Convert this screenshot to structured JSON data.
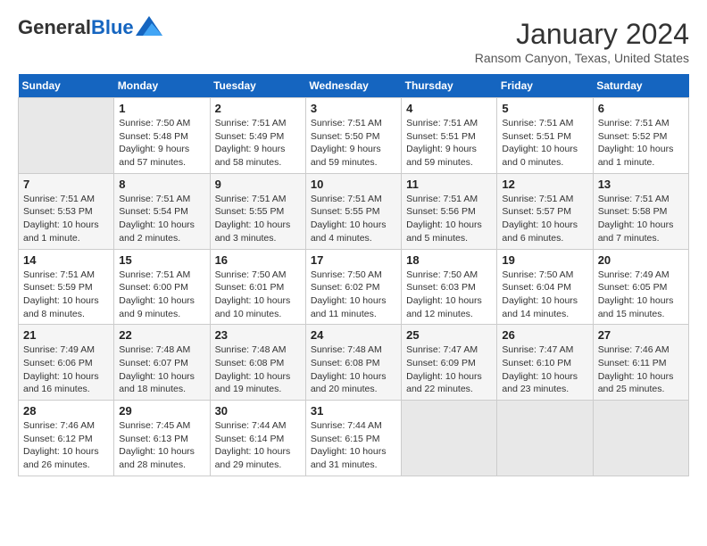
{
  "header": {
    "logo_general": "General",
    "logo_blue": "Blue",
    "month": "January 2024",
    "location": "Ransom Canyon, Texas, United States"
  },
  "weekdays": [
    "Sunday",
    "Monday",
    "Tuesday",
    "Wednesday",
    "Thursday",
    "Friday",
    "Saturday"
  ],
  "weeks": [
    [
      {
        "day": "",
        "empty": true
      },
      {
        "day": "1",
        "sunrise": "7:50 AM",
        "sunset": "5:48 PM",
        "daylight": "9 hours and 57 minutes."
      },
      {
        "day": "2",
        "sunrise": "7:51 AM",
        "sunset": "5:49 PM",
        "daylight": "9 hours and 58 minutes."
      },
      {
        "day": "3",
        "sunrise": "7:51 AM",
        "sunset": "5:50 PM",
        "daylight": "9 hours and 59 minutes."
      },
      {
        "day": "4",
        "sunrise": "7:51 AM",
        "sunset": "5:51 PM",
        "daylight": "9 hours and 59 minutes."
      },
      {
        "day": "5",
        "sunrise": "7:51 AM",
        "sunset": "5:51 PM",
        "daylight": "10 hours and 0 minutes."
      },
      {
        "day": "6",
        "sunrise": "7:51 AM",
        "sunset": "5:52 PM",
        "daylight": "10 hours and 1 minute."
      }
    ],
    [
      {
        "day": "7",
        "sunrise": "7:51 AM",
        "sunset": "5:53 PM",
        "daylight": "10 hours and 1 minute."
      },
      {
        "day": "8",
        "sunrise": "7:51 AM",
        "sunset": "5:54 PM",
        "daylight": "10 hours and 2 minutes."
      },
      {
        "day": "9",
        "sunrise": "7:51 AM",
        "sunset": "5:55 PM",
        "daylight": "10 hours and 3 minutes."
      },
      {
        "day": "10",
        "sunrise": "7:51 AM",
        "sunset": "5:55 PM",
        "daylight": "10 hours and 4 minutes."
      },
      {
        "day": "11",
        "sunrise": "7:51 AM",
        "sunset": "5:56 PM",
        "daylight": "10 hours and 5 minutes."
      },
      {
        "day": "12",
        "sunrise": "7:51 AM",
        "sunset": "5:57 PM",
        "daylight": "10 hours and 6 minutes."
      },
      {
        "day": "13",
        "sunrise": "7:51 AM",
        "sunset": "5:58 PM",
        "daylight": "10 hours and 7 minutes."
      }
    ],
    [
      {
        "day": "14",
        "sunrise": "7:51 AM",
        "sunset": "5:59 PM",
        "daylight": "10 hours and 8 minutes."
      },
      {
        "day": "15",
        "sunrise": "7:51 AM",
        "sunset": "6:00 PM",
        "daylight": "10 hours and 9 minutes."
      },
      {
        "day": "16",
        "sunrise": "7:50 AM",
        "sunset": "6:01 PM",
        "daylight": "10 hours and 10 minutes."
      },
      {
        "day": "17",
        "sunrise": "7:50 AM",
        "sunset": "6:02 PM",
        "daylight": "10 hours and 11 minutes."
      },
      {
        "day": "18",
        "sunrise": "7:50 AM",
        "sunset": "6:03 PM",
        "daylight": "10 hours and 12 minutes."
      },
      {
        "day": "19",
        "sunrise": "7:50 AM",
        "sunset": "6:04 PM",
        "daylight": "10 hours and 14 minutes."
      },
      {
        "day": "20",
        "sunrise": "7:49 AM",
        "sunset": "6:05 PM",
        "daylight": "10 hours and 15 minutes."
      }
    ],
    [
      {
        "day": "21",
        "sunrise": "7:49 AM",
        "sunset": "6:06 PM",
        "daylight": "10 hours and 16 minutes."
      },
      {
        "day": "22",
        "sunrise": "7:48 AM",
        "sunset": "6:07 PM",
        "daylight": "10 hours and 18 minutes."
      },
      {
        "day": "23",
        "sunrise": "7:48 AM",
        "sunset": "6:08 PM",
        "daylight": "10 hours and 19 minutes."
      },
      {
        "day": "24",
        "sunrise": "7:48 AM",
        "sunset": "6:08 PM",
        "daylight": "10 hours and 20 minutes."
      },
      {
        "day": "25",
        "sunrise": "7:47 AM",
        "sunset": "6:09 PM",
        "daylight": "10 hours and 22 minutes."
      },
      {
        "day": "26",
        "sunrise": "7:47 AM",
        "sunset": "6:10 PM",
        "daylight": "10 hours and 23 minutes."
      },
      {
        "day": "27",
        "sunrise": "7:46 AM",
        "sunset": "6:11 PM",
        "daylight": "10 hours and 25 minutes."
      }
    ],
    [
      {
        "day": "28",
        "sunrise": "7:46 AM",
        "sunset": "6:12 PM",
        "daylight": "10 hours and 26 minutes."
      },
      {
        "day": "29",
        "sunrise": "7:45 AM",
        "sunset": "6:13 PM",
        "daylight": "10 hours and 28 minutes."
      },
      {
        "day": "30",
        "sunrise": "7:44 AM",
        "sunset": "6:14 PM",
        "daylight": "10 hours and 29 minutes."
      },
      {
        "day": "31",
        "sunrise": "7:44 AM",
        "sunset": "6:15 PM",
        "daylight": "10 hours and 31 minutes."
      },
      {
        "day": "",
        "empty": true
      },
      {
        "day": "",
        "empty": true
      },
      {
        "day": "",
        "empty": true
      }
    ]
  ]
}
